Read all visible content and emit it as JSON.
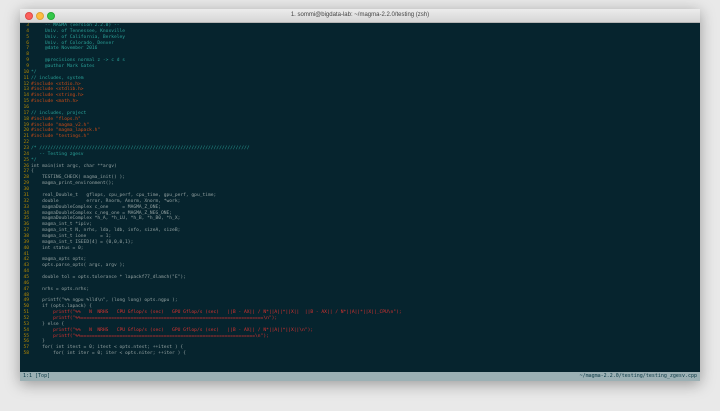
{
  "window": {
    "title": "1. sommi@bigdata-lab: ~/magma-2.2.0/testing (zsh)"
  },
  "status": {
    "left": "1:1 [Top]",
    "right": "~/magma-2.2.0/testing/testing_zgesv.cpp"
  },
  "lines": [
    {
      "n": "3",
      "t": "     -- MAGMA (version 2.2.0) --",
      "c": "c"
    },
    {
      "n": "4",
      "t": "     Univ. of Tennessee, Knoxville",
      "c": "c"
    },
    {
      "n": "5",
      "t": "     Univ. of California, Berkeley",
      "c": "c"
    },
    {
      "n": "6",
      "t": "     Univ. of Colorado, Denver",
      "c": "c"
    },
    {
      "n": "7",
      "t": "     @date November 2016",
      "c": "c"
    },
    {
      "n": "8",
      "t": "",
      "c": "n"
    },
    {
      "n": "9",
      "t": "     @precisions normal z -> c d s",
      "c": "c"
    },
    {
      "n": "9",
      "t": "     @author Mark Gates",
      "c": "c"
    },
    {
      "n": "10",
      "t": "*/",
      "c": "c"
    },
    {
      "n": "11",
      "t": "// includes, system",
      "c": "c"
    },
    {
      "n": "12",
      "t": "#include <stdio.h>",
      "c": "p"
    },
    {
      "n": "13",
      "t": "#include <stdlib.h>",
      "c": "p"
    },
    {
      "n": "14",
      "t": "#include <string.h>",
      "c": "p"
    },
    {
      "n": "15",
      "t": "#include <math.h>",
      "c": "p"
    },
    {
      "n": "16",
      "t": "",
      "c": "n"
    },
    {
      "n": "17",
      "t": "// includes, project",
      "c": "c"
    },
    {
      "n": "18",
      "t": "#include \"flops.h\"",
      "c": "p"
    },
    {
      "n": "19",
      "t": "#include \"magma_v2.h\"",
      "c": "p"
    },
    {
      "n": "20",
      "t": "#include \"magma_lapack.h\"",
      "c": "p"
    },
    {
      "n": "21",
      "t": "#include \"testings.h\"",
      "c": "p"
    },
    {
      "n": "22",
      "t": "",
      "c": "n"
    },
    {
      "n": "23",
      "t": "/* ////////////////////////////////////////////////////////////////////////////",
      "c": "c"
    },
    {
      "n": "24",
      "t": "   -- Testing zgesv",
      "c": "c"
    },
    {
      "n": "25",
      "t": "*/",
      "c": "c"
    },
    {
      "n": "26",
      "t": "int main(int argc, char **argv)",
      "c": "n"
    },
    {
      "n": "27",
      "t": "{",
      "c": "n"
    },
    {
      "n": "28",
      "t": "    TESTING_CHECK( magma_init() );",
      "c": "n"
    },
    {
      "n": "29",
      "t": "    magma_print_environment();",
      "c": "n"
    },
    {
      "n": "30",
      "t": "",
      "c": "n"
    },
    {
      "n": "31",
      "t": "    real_Double_t   gflops, cpu_perf, cpu_time, gpu_perf, gpu_time;",
      "c": "n"
    },
    {
      "n": "32",
      "t": "    double          error, Rnorm, Anorm, Xnorm, *work;",
      "c": "n"
    },
    {
      "n": "33",
      "t": "    magmaDoubleComplex c_one     = MAGMA_Z_ONE;",
      "c": "n"
    },
    {
      "n": "34",
      "t": "    magmaDoubleComplex c_neg_one = MAGMA_Z_NEG_ONE;",
      "c": "n"
    },
    {
      "n": "35",
      "t": "    magmaDoubleComplex *h_A, *h_LU, *h_B, *h_B0, *h_X;",
      "c": "n"
    },
    {
      "n": "36",
      "t": "    magma_int_t *ipiv;",
      "c": "n"
    },
    {
      "n": "37",
      "t": "    magma_int_t N, nrhs, lda, ldb, info, sizeA, sizeB;",
      "c": "n"
    },
    {
      "n": "38",
      "t": "    magma_int_t ione     = 1;",
      "c": "n"
    },
    {
      "n": "39",
      "t": "    magma_int_t ISEED[4] = {0,0,0,1};",
      "c": "n"
    },
    {
      "n": "40",
      "t": "    int status = 0;",
      "c": "n"
    },
    {
      "n": "41",
      "t": "",
      "c": "n"
    },
    {
      "n": "42",
      "t": "    magma_opts opts;",
      "c": "n"
    },
    {
      "n": "43",
      "t": "    opts.parse_opts( argc, argv );",
      "c": "n"
    },
    {
      "n": "44",
      "t": "",
      "c": "n"
    },
    {
      "n": "45",
      "t": "    double tol = opts.tolerance * lapackf77_dlamch(\"E\");",
      "c": "n"
    },
    {
      "n": "46",
      "t": "",
      "c": "n"
    },
    {
      "n": "47",
      "t": "    nrhs = opts.nrhs;",
      "c": "n"
    },
    {
      "n": "48",
      "t": "",
      "c": "n"
    },
    {
      "n": "49",
      "t": "    printf(\"%% ngpu %lld\\n\", (long long) opts.ngpu );",
      "c": "n"
    },
    {
      "n": "50",
      "t": "    if (opts.lapack) {",
      "c": "n"
    },
    {
      "n": "51",
      "t": "        printf(\"%%   N  NRHS   CPU Gflop/s (sec)   GPU Gflop/s (sec)   ||B - AX|| / N*||A||*||X||  ||B - AX|| / N*||A||*||X||_CPU\\n\");",
      "c": "s"
    },
    {
      "n": "52",
      "t": "        printf(\"%%==================================================================\\n\");",
      "c": "s"
    },
    {
      "n": "53",
      "t": "    } else {",
      "c": "n"
    },
    {
      "n": "54",
      "t": "        printf(\"%%   N  NRHS   CPU Gflop/s (sec)   GPU Gflop/s (sec)   ||B - AX|| / N*||A||*||X||\\n\");",
      "c": "s"
    },
    {
      "n": "55",
      "t": "        printf(\"%%===============================================================\\n\");",
      "c": "s"
    },
    {
      "n": "56",
      "t": "    }",
      "c": "n"
    },
    {
      "n": "57",
      "t": "    for( int itest = 0; itest < opts.ntest; ++itest ) {",
      "c": "n"
    },
    {
      "n": "58",
      "t": "        for( int iter = 0; iter < opts.niter; ++iter ) {",
      "c": "n"
    }
  ]
}
